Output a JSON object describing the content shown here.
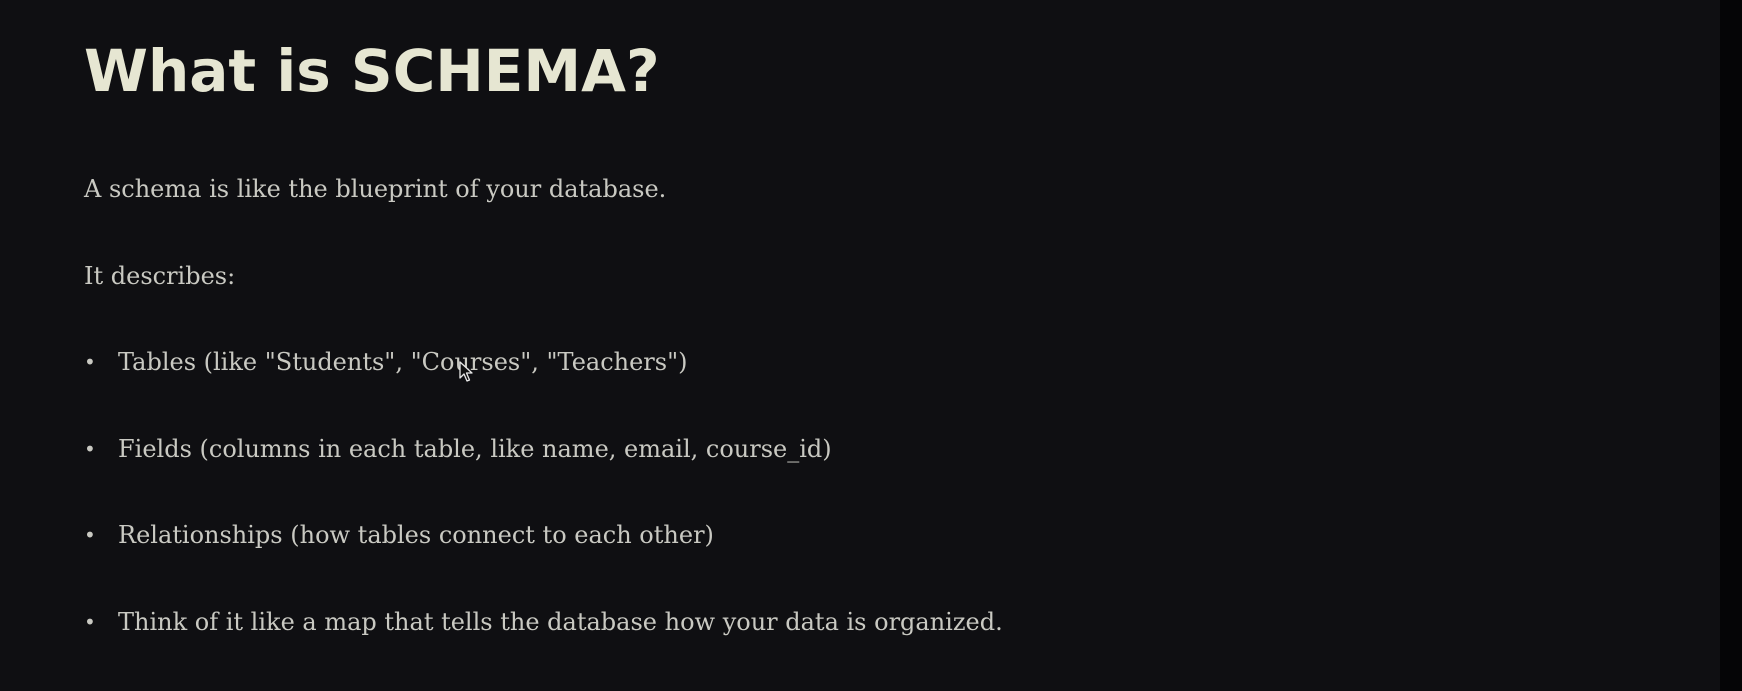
{
  "slide": {
    "title": "What is SCHEMA?",
    "intro": "A schema is like the blueprint of your database.",
    "describes_label": "It describes:",
    "bullet_glyph": "•",
    "bullets": [
      "Tables (like \"Students\", \"Courses\", \"Teachers\")",
      "Fields (columns in each table, like name, email, course_id)",
      "Relationships (how tables connect to each other)",
      "Think of it like a map that tells the database how your data is organized."
    ]
  },
  "colors": {
    "background": "#0f0f12",
    "title": "#e6e6d2",
    "body_text": "#c9c9c2"
  },
  "cursor": {
    "icon": "mouse-pointer-icon"
  }
}
